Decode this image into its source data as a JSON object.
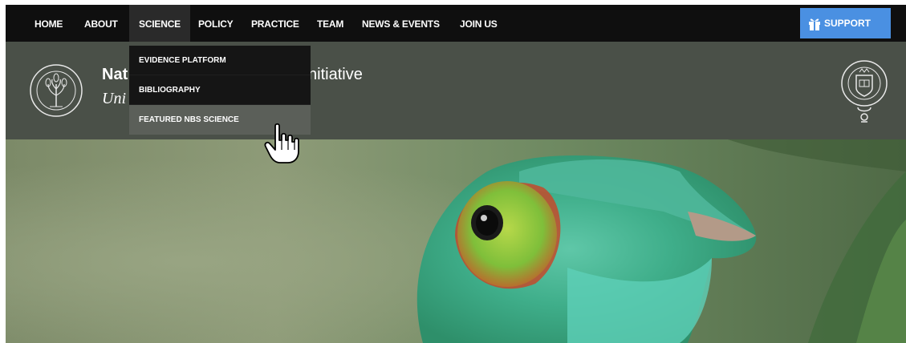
{
  "nav": {
    "items": [
      {
        "label": "HOME",
        "active": false
      },
      {
        "label": "ABOUT",
        "active": false
      },
      {
        "label": "SCIENCE",
        "active": true
      },
      {
        "label": "POLICY",
        "active": false
      },
      {
        "label": "PRACTICE",
        "active": false
      },
      {
        "label": "TEAM",
        "active": false
      },
      {
        "label": "NEWS & EVENTS",
        "active": false
      },
      {
        "label": "JOIN US",
        "active": false
      }
    ],
    "support_label": "SUPPORT",
    "support_color": "#4a90e2"
  },
  "header": {
    "title_visible": "Nat",
    "title_rest_visible": "nitiative",
    "subtitle_visible": "Uni"
  },
  "dropdown": {
    "items": [
      {
        "label": "EVIDENCE PLATFORM",
        "hovered": false
      },
      {
        "label": "BIBLIOGRAPHY",
        "hovered": false
      },
      {
        "label": "FEATURED NBS SCIENCE",
        "hovered": true
      }
    ]
  },
  "icons": {
    "support": "gift-icon",
    "left_logo": "tree-seal-icon",
    "right_logo": "university-crest-icon",
    "cursor": "hand-pointer-icon"
  },
  "hero": {
    "subject": "chameleon-photo"
  }
}
